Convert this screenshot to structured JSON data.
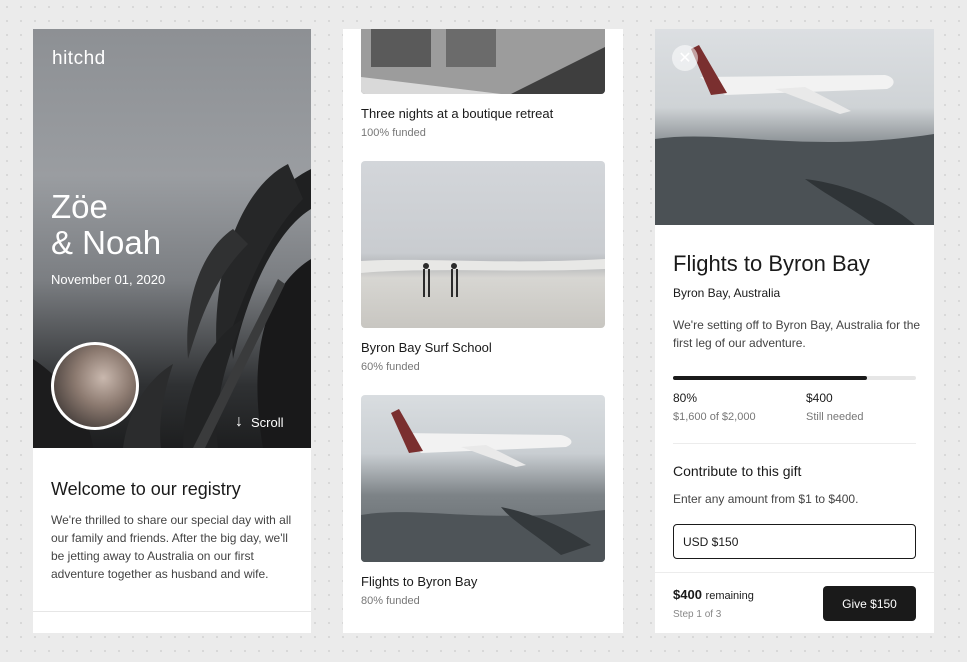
{
  "registry": {
    "logo": "hitchd",
    "couple_line1": "Zöe",
    "couple_line2": "& Noah",
    "date": "November 01, 2020",
    "scroll_label": "Scroll",
    "welcome_title": "Welcome to our registry",
    "welcome_body": "We're thrilled to share our special day with all our family and friends. After the big day, we'll be jetting away to Australia on our first adventure together as husband and wife."
  },
  "gifts": [
    {
      "title": "Three nights at a boutique retreat",
      "funded": "100% funded"
    },
    {
      "title": "Byron Bay Surf School",
      "funded": "60% funded"
    },
    {
      "title": "Flights to Byron Bay",
      "funded": "80% funded"
    }
  ],
  "detail": {
    "close_icon": "close-icon",
    "title": "Flights to Byron Bay",
    "location": "Byron Bay, Australia",
    "description": "We're setting off to Byron Bay, Australia for the first leg of our adventure.",
    "progress_fraction": 0.8,
    "stat_percent": "80%",
    "stat_raised": "$1,600 of $2,000",
    "stat_needed": "$400",
    "stat_needed_label": "Still needed",
    "contribute_title": "Contribute to this gift",
    "contribute_help": "Enter any amount from $1 to $400.",
    "amount_value": "USD $150",
    "remaining_amount": "$400",
    "remaining_label": "remaining",
    "step": "Step 1 of 3",
    "give_button": "Give $150"
  }
}
